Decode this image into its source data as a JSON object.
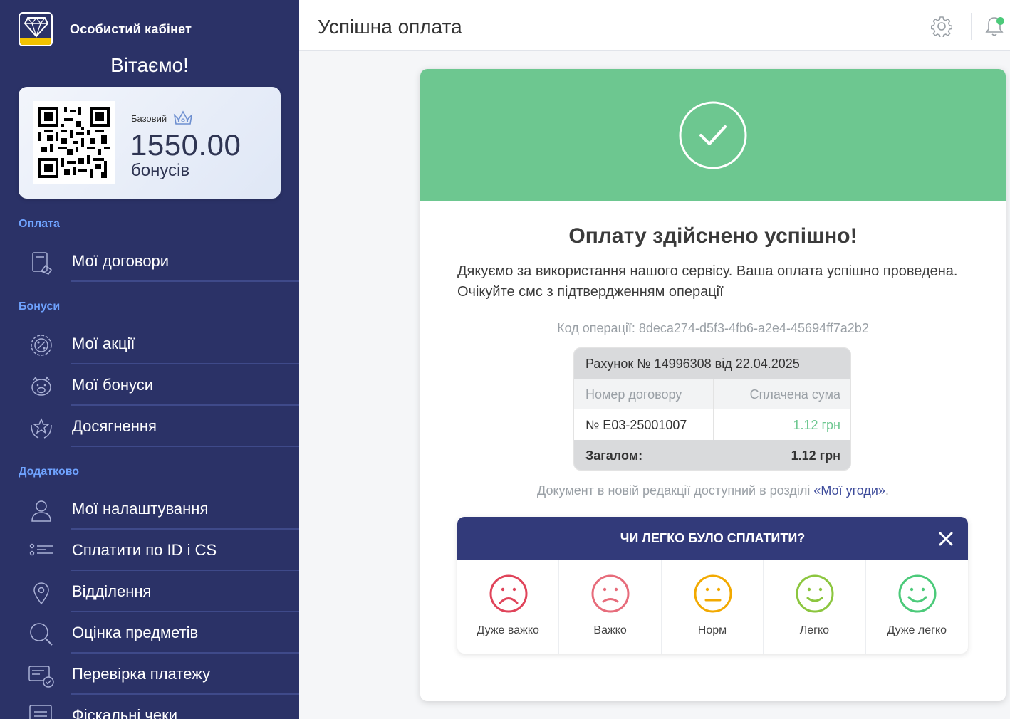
{
  "app": {
    "brand_title": "Особистий кабінет",
    "welcome": "Вітаємо!"
  },
  "bonus_card": {
    "tier": "Базовий",
    "amount": "1550.00",
    "unit": "бонусів"
  },
  "sidebar": {
    "sections": [
      {
        "title": "Оплата",
        "items": [
          {
            "label": "Мої договори",
            "icon": "contract-icon"
          }
        ]
      },
      {
        "title": "Бонуси",
        "items": [
          {
            "label": "Мої акції",
            "icon": "percent-badge-icon"
          },
          {
            "label": "Мої бонуси",
            "icon": "piggy-bank-icon"
          },
          {
            "label": "Досягнення",
            "icon": "laurel-star-icon"
          }
        ]
      },
      {
        "title": "Додатково",
        "items": [
          {
            "label": "Мої налаштування",
            "icon": "user-icon"
          },
          {
            "label": "Сплатити по ID і CS",
            "icon": "list-icon"
          },
          {
            "label": "Відділення",
            "icon": "map-pin-icon"
          },
          {
            "label": "Оцінка предметів",
            "icon": "magnifier-icon"
          },
          {
            "label": "Перевірка платежу",
            "icon": "payment-check-icon"
          },
          {
            "label": "Фіскальні чеки",
            "icon": "receipt-icon"
          }
        ]
      }
    ]
  },
  "topbar": {
    "title": "Успішна оплата"
  },
  "result": {
    "title": "Оплату здійснено успішно!",
    "text": "Дякуємо за використання нашого сервісу. Ваша оплата успішно проведена. Очікуйте смс з підтвердженням операції",
    "op_code": "Код операції: 8deca274-d5f3-4fb6-a2e4-45694ff7a2b2"
  },
  "invoice": {
    "header": "Рахунок № 14996308 від 22.04.2025",
    "col_contract": "Номер договору",
    "col_amount": "Сплачена сума",
    "contract": "№ E03-25001007",
    "amount": "1.12 грн",
    "total_label": "Загалом:",
    "total": "1.12 грн"
  },
  "doc_note": {
    "text": "Документ в новій редакції доступний в розділі ",
    "link": "«Мої угоди»",
    "tail": "."
  },
  "feedback": {
    "title": "ЧИ ЛЕГКО БУЛО СПЛАТИТИ?",
    "options": [
      {
        "label": "Дуже важко",
        "color": "#e0445a"
      },
      {
        "label": "Важко",
        "color": "#e76c7b"
      },
      {
        "label": "Норм",
        "color": "#f2a900"
      },
      {
        "label": "Легко",
        "color": "#8cc63f"
      },
      {
        "label": "Дуже легко",
        "color": "#4cca7a"
      }
    ]
  },
  "colors": {
    "sidebar_bg": "#2b3267",
    "section_title": "#6fa3ff",
    "success_green": "#6dc790",
    "feedback_header": "#323a7a"
  }
}
